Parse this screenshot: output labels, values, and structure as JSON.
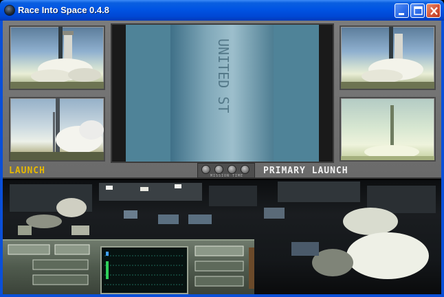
{
  "window": {
    "title": "Race Into Space 0.4.8",
    "controls": {
      "minimize": "minimize",
      "maximize": "maximize",
      "close": "close"
    }
  },
  "monitors": {
    "left_label": "LAUNCH",
    "right_label": "PRIMARY LAUNCH",
    "time_control_label": "MISSION TIME",
    "rocket_text": "UNITED ST"
  },
  "colors": {
    "titlebar": "#0054e3",
    "launch_label": "#e6b800",
    "primary_label": "#f2f2f2",
    "panel": "#7c7c7c"
  }
}
